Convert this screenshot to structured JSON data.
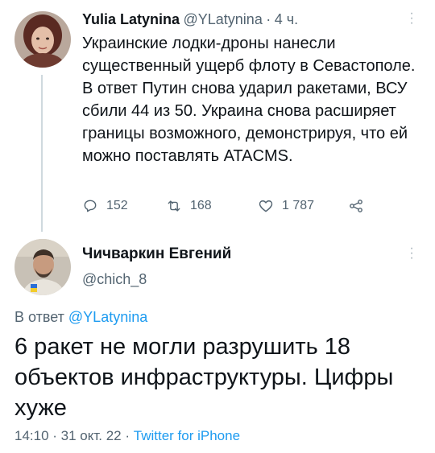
{
  "tweet1": {
    "author_name": "Yulia Latynina",
    "handle": "@YLatynina",
    "separator": "·",
    "time": "4 ч.",
    "text": "Украинские лодки-дроны нанесли существенный ущерб флоту в Севастополе. В ответ Путин снова ударил ракетами, ВСУ сбили 44 из 50. Украина снова расширяет границы возможного, демонстрируя, что ей можно поставлять ATACMS.",
    "actions": {
      "replies": "152",
      "retweets": "168",
      "likes": "1 787"
    },
    "icons": [
      "reply-icon",
      "retweet-icon",
      "like-icon",
      "share-icon",
      "more-icon"
    ]
  },
  "tweet2": {
    "author_name": "Чичваркин Евгений",
    "handle": "@chich_8",
    "reply_prefix": "В ответ",
    "reply_handle": "@YLatynina",
    "text": "6 ракет не могли разрушить 18 объектов инфраструктуры. Цифры хуже",
    "time_date": "14:10 · 31 окт. 22 ·",
    "source": "Twitter for iPhone"
  },
  "colors": {
    "link": "#1d9bf0",
    "secondary_text": "#536471",
    "primary_text": "#0f1419",
    "thread_line": "#cfd9de"
  }
}
